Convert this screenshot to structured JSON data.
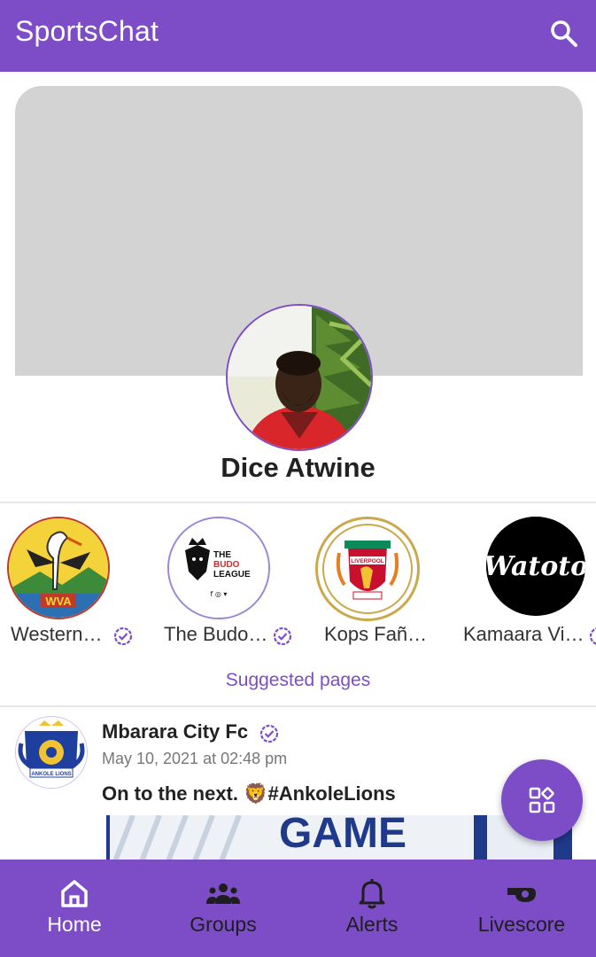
{
  "app": {
    "title": "SportsChat"
  },
  "colors": {
    "primary": "#7c4dc7",
    "cover": "#d3d3d3",
    "nav_active": "#ffffff",
    "nav_inactive": "#1e1e1e"
  },
  "profile": {
    "name": "Dice Atwine"
  },
  "suggested_pages": {
    "label": "Suggested pages",
    "items": [
      {
        "name": "Western…",
        "verified": true,
        "logo": "stork-crest-logo"
      },
      {
        "name": "The Budo…",
        "verified": true,
        "logo": "lion-league-logo"
      },
      {
        "name": "Kops Fañ…",
        "verified": false,
        "logo": "liverpool-crest-logo"
      },
      {
        "name": "Kamaara Vi…",
        "verified": true,
        "logo": "watoto-logo"
      }
    ],
    "logo_texts": {
      "wva": "WVA",
      "budo": "THE BUDO LEAGUE",
      "liverpool": "LIVERPOOL",
      "watoto": "Watoto"
    }
  },
  "post": {
    "author": "Mbarara City Fc",
    "verified": true,
    "time": "May 10, 2021 at 02:48 pm",
    "text": "On to the next. 🦁#AnkoleLions",
    "image_text": "GAME",
    "avatar_text": "ANKOLE LIONS"
  },
  "fab": {
    "icon": "apps-grid-icon"
  },
  "nav": {
    "items": [
      {
        "label": "Home",
        "icon": "home-icon",
        "active": true
      },
      {
        "label": "Groups",
        "icon": "groups-icon",
        "active": false
      },
      {
        "label": "Alerts",
        "icon": "bell-icon",
        "active": false
      },
      {
        "label": "Livescore",
        "icon": "whistle-icon",
        "active": false
      }
    ]
  }
}
